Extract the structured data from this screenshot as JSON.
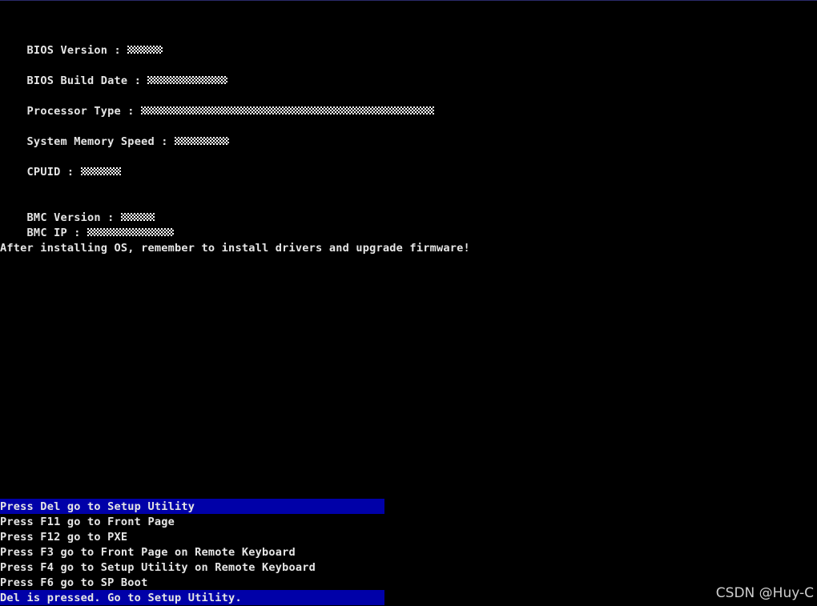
{
  "info": {
    "bios_version": "BIOS Version : ",
    "bios_build_date": "BIOS Build Date : ",
    "processor_type": "Processor Type : ",
    "memory_speed": "System Memory Speed : ",
    "cpuid": "CPUID : ",
    "bmc_version": "BMC Version : ",
    "bmc_ip": "BMC IP : ",
    "notice": "After installing OS, remember to install drivers and upgrade firmware!"
  },
  "hotkeys": [
    "Press Del go to Setup Utility",
    "Press F11 go to Front Page",
    "Press F12 go to PXE",
    "Press F3 go to Front Page on Remote Keyboard",
    "Press F4 go to Setup Utility on Remote Keyboard",
    "Press F6 go to SP Boot"
  ],
  "status": "Del is pressed. Go to Setup Utility.",
  "watermark": "CSDN @Huy-C",
  "colors": {
    "background": "#000000",
    "text": "#e6e6e6",
    "highlight": "#0000a8"
  }
}
